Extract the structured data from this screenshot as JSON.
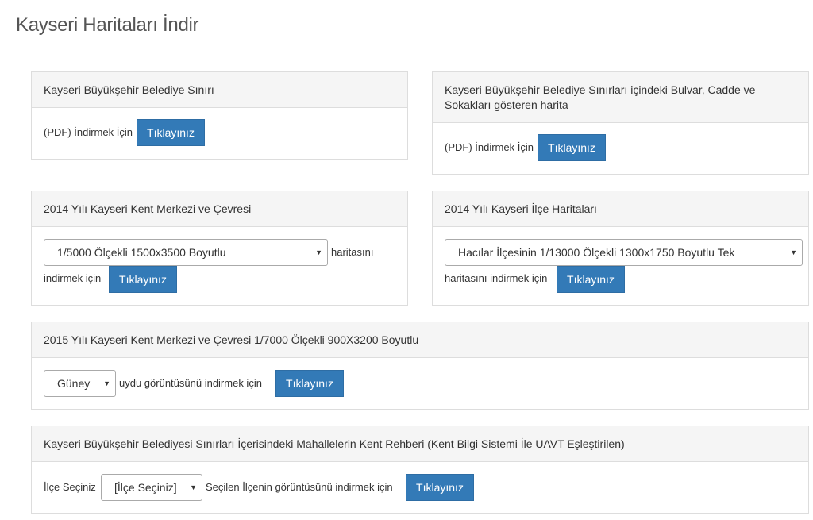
{
  "page": {
    "title": "Kayseri Haritaları İndir"
  },
  "panel1": {
    "heading": "Kayseri Büyükşehir Belediye Sınırı",
    "text": "(PDF) İndirmek İçin",
    "button": "Tıklayınız"
  },
  "panel2": {
    "heading_line1": "Kayseri Büyükşehir Belediye Sınırları içindeki Bulvar, Cadde ve",
    "heading_line2": "Sokakları gösteren harita",
    "text": "(PDF) İndirmek İçin",
    "button": "Tıklayınız"
  },
  "panel3": {
    "heading": "2014 Yılı Kayseri Kent Merkezi ve Çevresi",
    "select_value": "1/5000 Ölçekli 1500x3500 Boyutlu",
    "text_after_select": "haritasını",
    "text_line2": "indirmek için",
    "button": "Tıklayınız"
  },
  "panel4": {
    "heading": "2014 Yılı Kayseri İlçe Haritaları",
    "select_value": "Hacılar İlçesinin 1/13000 Ölçekli 1300x1750 Boyutlu Tek",
    "text_line2": "haritasını indirmek için",
    "button": "Tıklayınız"
  },
  "panel5": {
    "heading": "2015 Yılı Kayseri Kent Merkezi ve Çevresi 1/7000 Ölçekli 900X3200 Boyutlu",
    "select_value": "Güney",
    "text": "uydu görüntüsünü indirmek için",
    "button": "Tıklayınız"
  },
  "panel6": {
    "heading": "Kayseri Büyükşehir Belediyesi Sınırları İçerisindeki Mahallelerin Kent Rehberi (Kent Bilgi Sistemi İle UAVT Eşleştirilen)",
    "label": "İlçe Seçiniz",
    "select_value": "[İlçe Seçiniz]",
    "text": "Seçilen İlçenin görüntüsünü indirmek için",
    "button": "Tıklayınız"
  },
  "icons": {
    "select_caret": "▼"
  }
}
